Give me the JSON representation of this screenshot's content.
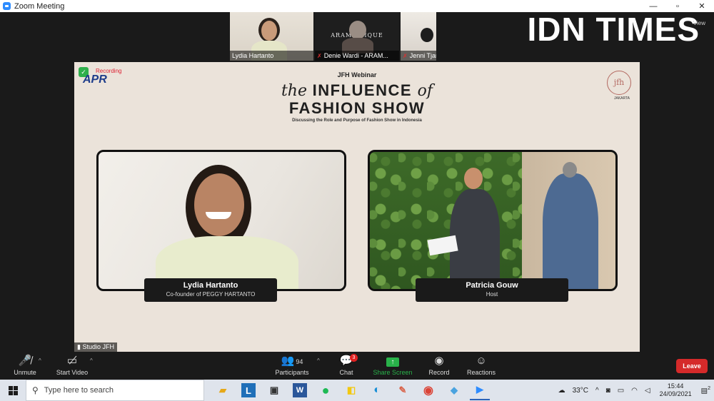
{
  "window": {
    "title": "Zoom Meeting",
    "controls": [
      "—",
      "▫",
      "✕"
    ]
  },
  "watermark": "IDN TIMES",
  "view_label": "View",
  "thumbnails": [
    {
      "name": "Lydia Hartanto",
      "muted": false
    },
    {
      "name": "Denie Wardi - ARAM...",
      "muted": true,
      "banner": "ARAMAR   IQUE"
    },
    {
      "name": "Jenni Tjandra",
      "muted": true
    }
  ],
  "stage": {
    "brand": "APR",
    "recording": "Recording",
    "logo_text": "jfh",
    "logo_sub": "JAKARTA",
    "webinar": "JFH Webinar",
    "headline_the": "the",
    "headline_influence": "INFLUENCE",
    "headline_of": "of",
    "headline_line2": "FASHION SHOW",
    "subtitle": "Discussing the Role and Purpose of Fashion Show in Indonesia",
    "speaker_left": {
      "name": "Lydia Hartanto",
      "role": "Co-founder of PEGGY HARTANTO"
    },
    "speaker_right": {
      "name": "Patricia Gouw",
      "role": "Host"
    }
  },
  "studio_label": "Studio JFH",
  "toolbar": {
    "unmute": "Unmute",
    "start_video": "Start Video",
    "participants": "Participants",
    "participants_count": "94",
    "chat": "Chat",
    "chat_badge": "3",
    "share_screen": "Share Screen",
    "record": "Record",
    "reactions": "Reactions",
    "leave": "Leave"
  },
  "taskbar": {
    "search_placeholder": "Type here to search",
    "temperature": "33°C",
    "time": "15:44",
    "date": "24/09/2021",
    "notifications": "2"
  },
  "colors": {
    "share_green": "#29b24a",
    "leave_red": "#d52a2a",
    "slide_bg": "#ebe3da"
  }
}
